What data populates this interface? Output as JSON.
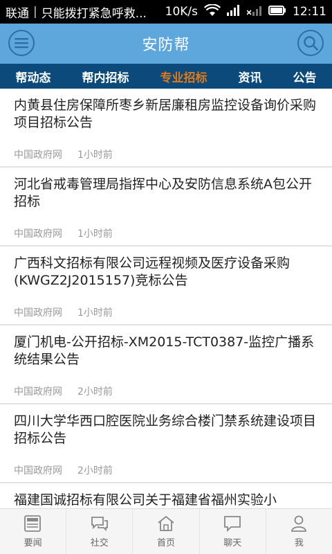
{
  "status_bar": {
    "carrier": "联通",
    "notice": "只能拨打紧急呼救...",
    "speed": "10K/s",
    "time": "12:11"
  },
  "header": {
    "title": "安防帮",
    "accent_color": "#5ea7dd"
  },
  "tabs": [
    {
      "label": "帮动态",
      "active": false
    },
    {
      "label": "帮内招标",
      "active": false
    },
    {
      "label": "专业招标",
      "active": true
    },
    {
      "label": "资讯",
      "active": false
    },
    {
      "label": "公告",
      "active": false
    }
  ],
  "articles": [
    {
      "title": "内黄县住房保障所枣乡新居廉租房监控设备询价采购项目招标公告",
      "source": "中国政府网",
      "time": "1小时前"
    },
    {
      "title": "河北省戒毒管理局指挥中心及安防信息系统A包公开招标",
      "source": "中国政府网",
      "time": "1小时前"
    },
    {
      "title": "广西科文招标有限公司远程视频及医疗设备采购(KWGZ2J2015157)竞标公告",
      "source": "中国政府网",
      "time": "1小时前"
    },
    {
      "title": "厦门机电-公开招标-XM2015-TCT0387-监控广播系统结果公告",
      "source": "中国政府网",
      "time": "2小时前"
    },
    {
      "title": "四川大学华西口腔医院业务综合楼门禁系统建设项目招标公告",
      "source": "中国政府网",
      "time": "2小时前"
    },
    {
      "title": "福建国诚招标有限公司关于福建省福州实验小",
      "source": "",
      "time": ""
    }
  ],
  "bottom_nav": [
    {
      "label": "要闻",
      "icon": "news-icon"
    },
    {
      "label": "社交",
      "icon": "chat-bubbles-icon"
    },
    {
      "label": "首页",
      "icon": "home-icon"
    },
    {
      "label": "聊天",
      "icon": "chat-icon"
    },
    {
      "label": "我",
      "icon": "user-icon"
    }
  ]
}
